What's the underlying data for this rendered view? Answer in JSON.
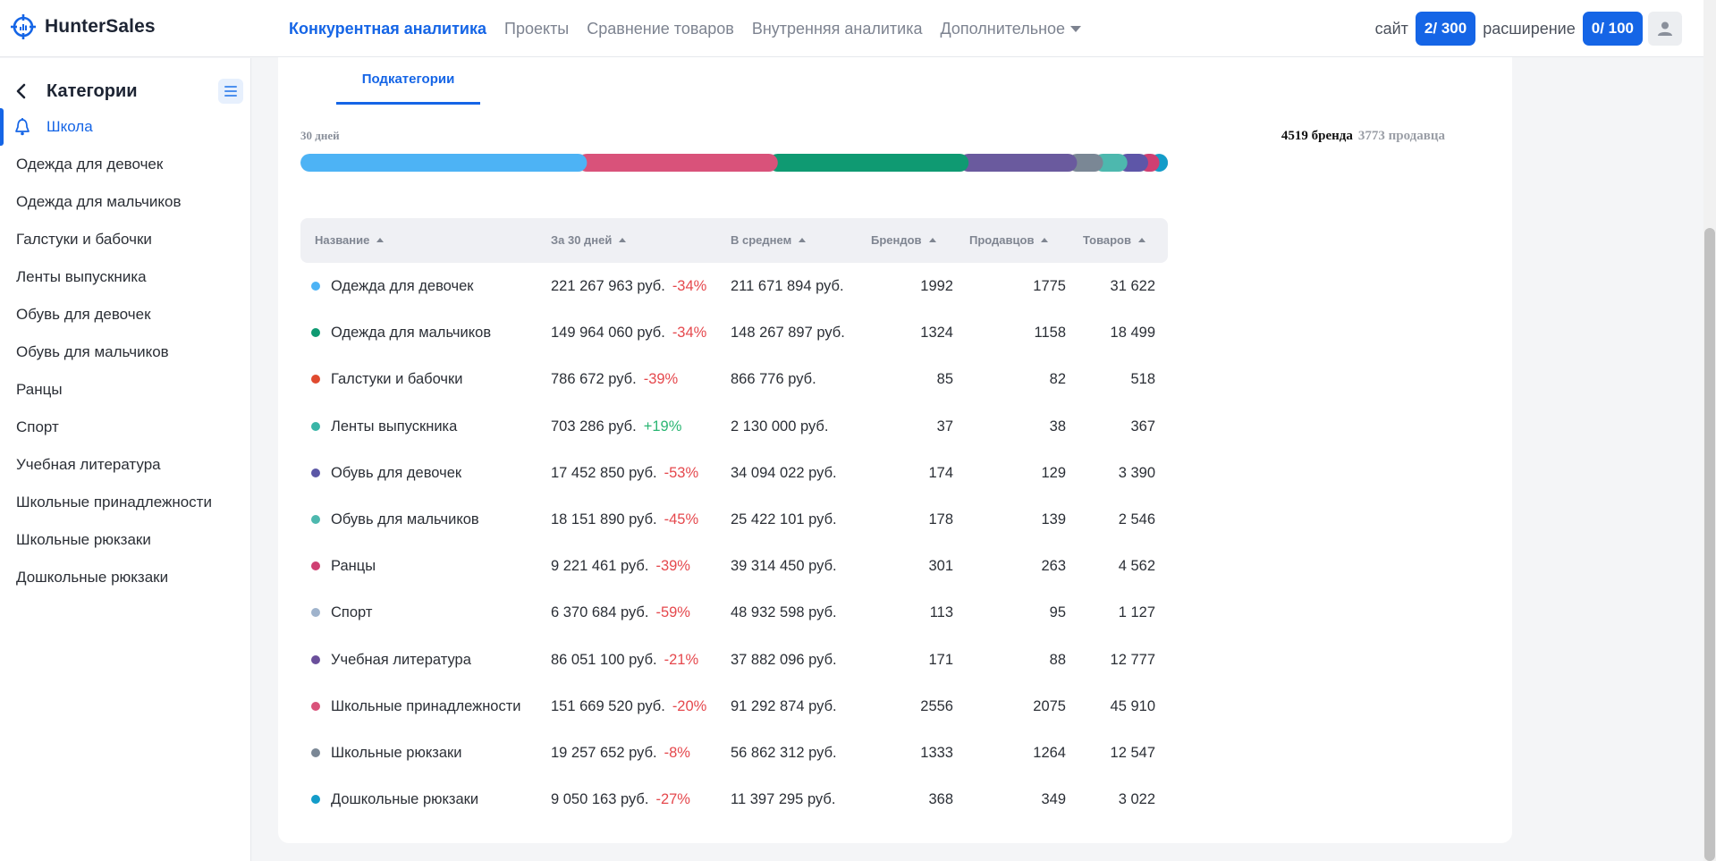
{
  "app": {
    "logo_text": "HunterSales",
    "logo_icon": "crosshair-target-icon"
  },
  "nav": {
    "items": [
      {
        "label": "Конкурентная аналитика",
        "active": true
      },
      {
        "label": "Проекты",
        "active": false
      },
      {
        "label": "Сравнение товаров",
        "active": false
      },
      {
        "label": "Внутренняя аналитика",
        "active": false
      },
      {
        "label": "Дополнительное",
        "active": false,
        "dropdown": true
      }
    ]
  },
  "limits": {
    "site_label": "сайт",
    "site_value": "2/ 300",
    "ext_label": "расширение",
    "ext_value": "0/ 100"
  },
  "sidebar": {
    "title": "Категории",
    "active_item": "Школа",
    "items": [
      "Одежда для девочек",
      "Одежда для мальчиков",
      "Галстуки и бабочки",
      "Ленты выпускника",
      "Обувь для девочек",
      "Обувь для мальчиков",
      "Ранцы",
      "Спорт",
      "Учебная литература",
      "Школьные принадлежности",
      "Школьные рюкзаки",
      "Дошкольные рюкзаки"
    ]
  },
  "content": {
    "tab_label": "Подкатегории",
    "period_label": "30 дней",
    "brands_count": "4519 бренда",
    "sellers_count": "3773 продавца"
  },
  "share_bar": {
    "segments": [
      {
        "color": "#4db3f5",
        "share": 0.32
      },
      {
        "color": "#d9527a",
        "share": 0.22
      },
      {
        "color": "#0f9a72",
        "share": 0.22
      },
      {
        "color": "#6a5a9e",
        "share": 0.125
      },
      {
        "color": "#7a8795",
        "share": 0.03
      },
      {
        "color": "#4db8ae",
        "share": 0.028
      },
      {
        "color": "#5e56a8",
        "share": 0.024
      },
      {
        "color": "#cf3f72",
        "share": 0.013
      },
      {
        "color": "#139cc9",
        "share": 0.015
      },
      {
        "color": "#b0b4ba",
        "share": 0.003
      },
      {
        "color": "#e8553f",
        "share": 0.003
      }
    ]
  },
  "table": {
    "headers": [
      "Название",
      "За 30 дней",
      "В среднем",
      "Брендов",
      "Продавцов",
      "Товаров"
    ],
    "rows": [
      {
        "color": "#4db3f5",
        "name": "Одежда для девочек",
        "sum": "221 267 963 руб.",
        "pct": "-34%",
        "trend": "neg",
        "avg": "211 671 894 руб.",
        "brands": "1992",
        "sellers": "1775",
        "goods": "31 622"
      },
      {
        "color": "#0f9a72",
        "name": "Одежда для мальчиков",
        "sum": "149 964 060 руб.",
        "pct": "-34%",
        "trend": "neg",
        "avg": "148 267 897 руб.",
        "brands": "1324",
        "sellers": "1158",
        "goods": "18 499"
      },
      {
        "color": "#e04a2f",
        "name": "Галстуки и бабочки",
        "sum": "786 672 руб.",
        "pct": "-39%",
        "trend": "neg",
        "avg": "866 776 руб.",
        "brands": "85",
        "sellers": "82",
        "goods": "518"
      },
      {
        "color": "#39b5a7",
        "name": "Ленты выпускника",
        "sum": "703 286 руб.",
        "pct": "+19%",
        "trend": "pos",
        "avg": "2 130 000 руб.",
        "brands": "37",
        "sellers": "38",
        "goods": "367"
      },
      {
        "color": "#5b57a6",
        "name": "Обувь для девочек",
        "sum": "17 452 850 руб.",
        "pct": "-53%",
        "trend": "neg",
        "avg": "34 094 022 руб.",
        "brands": "174",
        "sellers": "129",
        "goods": "3 390"
      },
      {
        "color": "#4db8ae",
        "name": "Обувь для мальчиков",
        "sum": "18 151 890 руб.",
        "pct": "-45%",
        "trend": "neg",
        "avg": "25 422 101 руб.",
        "brands": "178",
        "sellers": "139",
        "goods": "2 546"
      },
      {
        "color": "#cf3f72",
        "name": "Ранцы",
        "sum": "9 221 461 руб.",
        "pct": "-39%",
        "trend": "neg",
        "avg": "39 314 450 руб.",
        "brands": "301",
        "sellers": "263",
        "goods": "4 562"
      },
      {
        "color": "#9fb3cc",
        "name": "Спорт",
        "sum": "6 370 684 руб.",
        "pct": "-59%",
        "trend": "neg",
        "avg": "48 932 598 руб.",
        "brands": "113",
        "sellers": "95",
        "goods": "1 127"
      },
      {
        "color": "#6a4f9b",
        "name": "Учебная литература",
        "sum": "86 051 100 руб.",
        "pct": "-21%",
        "trend": "neg",
        "avg": "37 882 096 руб.",
        "brands": "171",
        "sellers": "88",
        "goods": "12 777"
      },
      {
        "color": "#d9527a",
        "name": "Школьные принадлежности",
        "sum": "151 669 520 руб.",
        "pct": "-20%",
        "trend": "neg",
        "avg": "91 292 874 руб.",
        "brands": "2556",
        "sellers": "2075",
        "goods": "45 910"
      },
      {
        "color": "#7a8795",
        "name": "Школьные рюкзаки",
        "sum": "19 257 652 руб.",
        "pct": "-8%",
        "trend": "neg",
        "avg": "56 862 312 руб.",
        "brands": "1333",
        "sellers": "1264",
        "goods": "12 547"
      },
      {
        "color": "#139cc9",
        "name": "Дошкольные рюкзаки",
        "sum": "9 050 163 руб.",
        "pct": "-27%",
        "trend": "neg",
        "avg": "11 397 295 руб.",
        "brands": "368",
        "sellers": "349",
        "goods": "3 022"
      }
    ]
  }
}
